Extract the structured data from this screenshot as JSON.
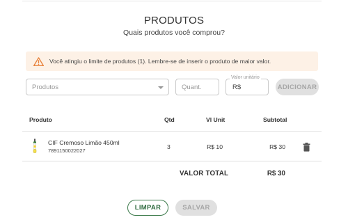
{
  "header": {
    "title": "PRODUTOS",
    "subtitle": "Quais produtos você comprou?"
  },
  "alert": {
    "icon": "warning-icon",
    "message": "Você atingiu o limite de produtos (1). Lembre-se de inserir o produto de maior valor.",
    "color": "#fdf1e6",
    "icon_color": "#e8813a"
  },
  "form": {
    "product_placeholder": "Produtos",
    "quantity_placeholder": "Quant.",
    "unit_value_label": "Valor unitário",
    "unit_value_prefix": "R$",
    "add_label": "ADICIONAR"
  },
  "table": {
    "columns": [
      "Produto",
      "Qtd",
      "Vl Unit",
      "Subtotal"
    ],
    "rows": [
      {
        "name": "CIF Cremoso Limão 450ml",
        "code": "7891150022027",
        "qtd": "3",
        "unit": "R$ 10",
        "subtotal": "R$ 30"
      }
    ]
  },
  "total": {
    "label": "VALOR TOTAL",
    "value": "R$ 30"
  },
  "actions": {
    "clear_label": "LIMPAR",
    "save_label": "SALVAR"
  },
  "colors": {
    "primary": "#3c7a4b",
    "disabled_bg": "#e0e0e0",
    "disabled_text": "#a6a6a6"
  }
}
